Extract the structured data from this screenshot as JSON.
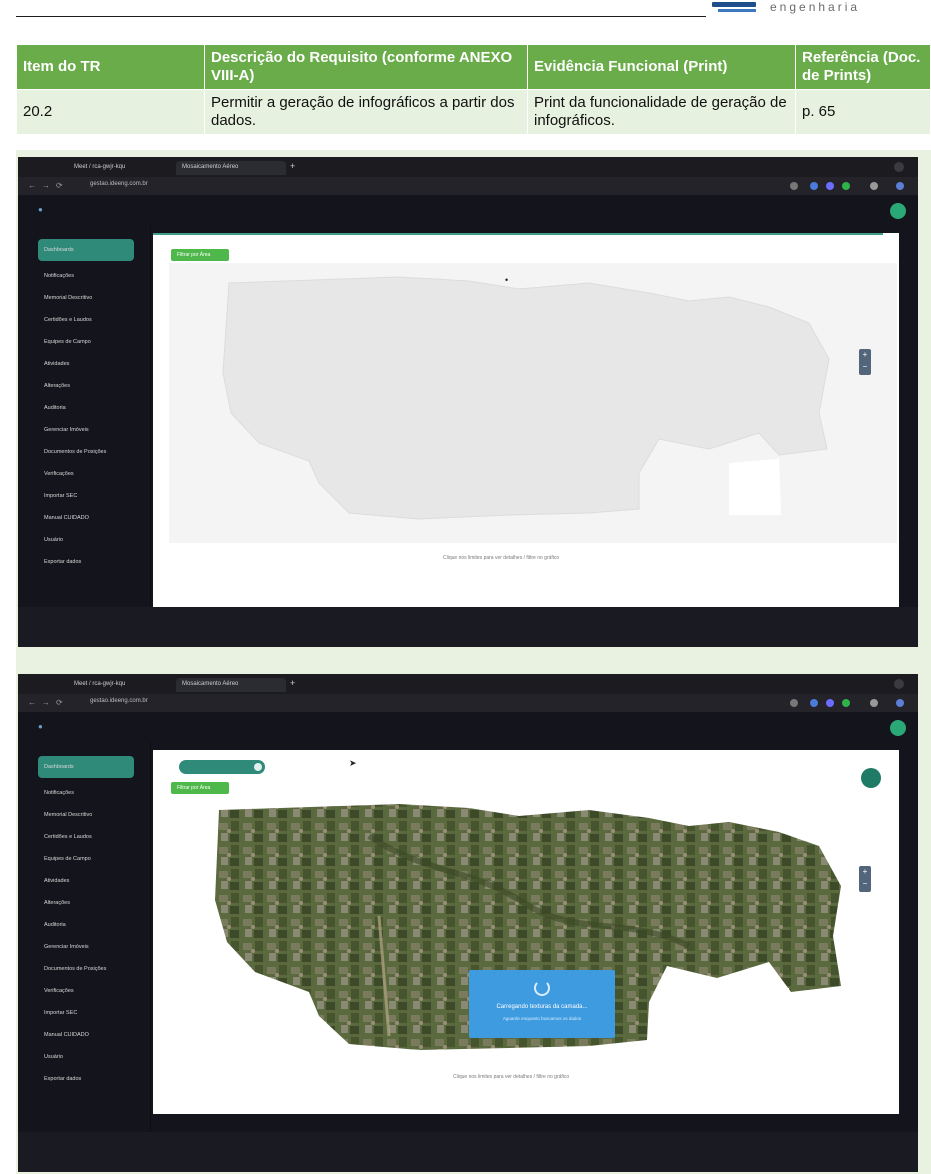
{
  "header": {
    "logo_text": "engenharia"
  },
  "table": {
    "headers": [
      "Item do TR",
      "Descrição do Requisito (conforme ANEXO VIII-A)",
      "Evidência Funcional (Print)",
      "Referência (Doc. de Prints)"
    ],
    "row": {
      "item": "20.2",
      "description": "Permitir a geração de infográficos a partir dos dados.",
      "evidence": "Print da funcionalidade de geração de infográficos.",
      "reference": "p. 65"
    }
  },
  "colors": {
    "header_green": "#6aab4a",
    "row_green": "#e7f1df",
    "teal_accent": "#2f8a7a",
    "filter_green": "#4fb84a",
    "loading_blue": "#3f9be0"
  },
  "screenshot1": {
    "tabs": [
      "Meet / rca-gwjr-kqu",
      "Mosaicamento Aéreo"
    ],
    "url": "gestao.ideeng.com.br",
    "sidebar": [
      "Dashboards",
      "Notificações",
      "Memorial Descritivo",
      "Certidões e Laudos",
      "Equipes de Campo",
      "Atividades",
      "Alterações",
      "Auditoria",
      "Gerenciar Imóveis",
      "Documentos de Posições",
      "Verificações",
      "Importar SEC",
      "Manual CUIDADO",
      "Usuário",
      "Exportar dados"
    ],
    "filter_label": "Filtrar por Área",
    "map_note": "Clique nos limites para ver detalhes / filtre no gráfico"
  },
  "screenshot2": {
    "tabs": [
      "Meet / rca-gwjr-kqu",
      "Mosaicamento Aéreo"
    ],
    "url": "gestao.ideeng.com.br",
    "sidebar": [
      "Dashboards",
      "Notificações",
      "Memorial Descritivo",
      "Certidões e Laudos",
      "Equipes de Campo",
      "Atividades",
      "Alterações",
      "Auditoria",
      "Gerenciar Imóveis",
      "Documentos de Posições",
      "Verificações",
      "Importar SEC",
      "Manual CUIDADO",
      "Usuário",
      "Exportar dados"
    ],
    "filter_label": "Filtrar por Área",
    "loading_title": "Carregando texturas da camada...",
    "loading_sub": "Aguarde enquanto buscamos os dados",
    "map_note": "Clique nos limites para ver detalhes / filtre no gráfico"
  }
}
